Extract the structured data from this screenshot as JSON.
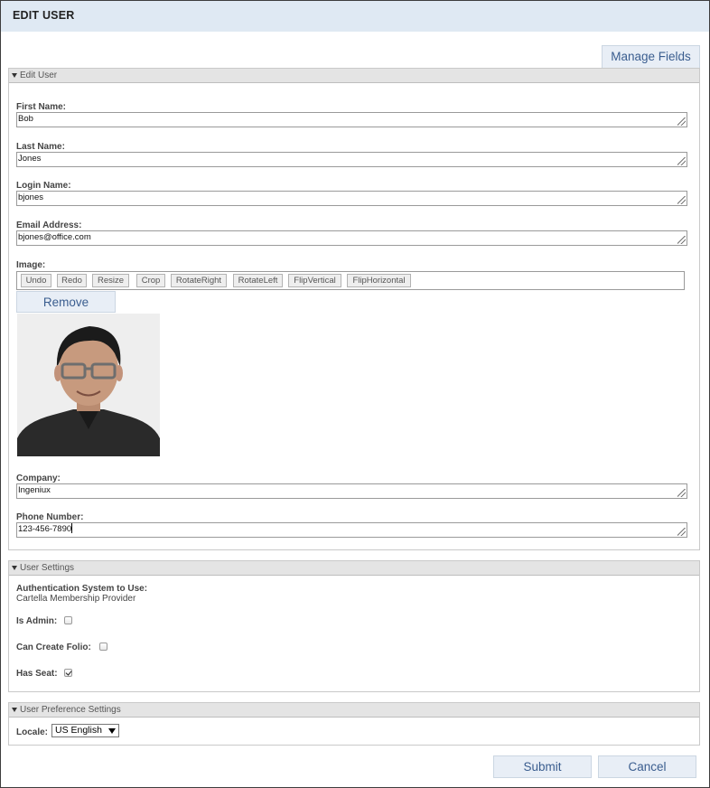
{
  "header": {
    "title": "EDIT USER"
  },
  "manage_fields_label": "Manage Fields",
  "edit_user": {
    "section_label": "Edit User",
    "first_name": {
      "label": "First Name:",
      "value": "Bob"
    },
    "last_name": {
      "label": "Last Name:",
      "value": "Jones"
    },
    "login_name": {
      "label": "Login Name:",
      "value": "bjones"
    },
    "email": {
      "label": "Email Address:",
      "value": "bjones@office.com"
    },
    "image": {
      "label": "Image:",
      "toolbar": [
        "Undo",
        "Redo",
        "Resize",
        "Crop",
        "RotateRight",
        "RotateLeft",
        "FlipVertical",
        "FlipHorizontal"
      ],
      "remove_label": "Remove"
    },
    "company": {
      "label": "Company:",
      "value": "Ingeniux"
    },
    "phone": {
      "label": "Phone Number:",
      "value": "123-456-7890"
    }
  },
  "user_settings": {
    "section_label": "User Settings",
    "auth_label": "Authentication System to Use:",
    "auth_value": "Cartella Membership Provider",
    "is_admin": {
      "label": "Is Admin:",
      "checked": false
    },
    "can_create_folio": {
      "label": "Can Create Folio:",
      "checked": false
    },
    "has_seat": {
      "label": "Has Seat:",
      "checked": true
    }
  },
  "preferences": {
    "section_label": "User Preference Settings",
    "locale_label": "Locale:",
    "locale_value": "US English"
  },
  "actions": {
    "submit": "Submit",
    "cancel": "Cancel"
  },
  "colors": {
    "title_bar": "#dfe9f3",
    "button_bg": "#e8eef6",
    "button_text": "#3a5d8f",
    "panel_header": "#e4e4e4"
  }
}
